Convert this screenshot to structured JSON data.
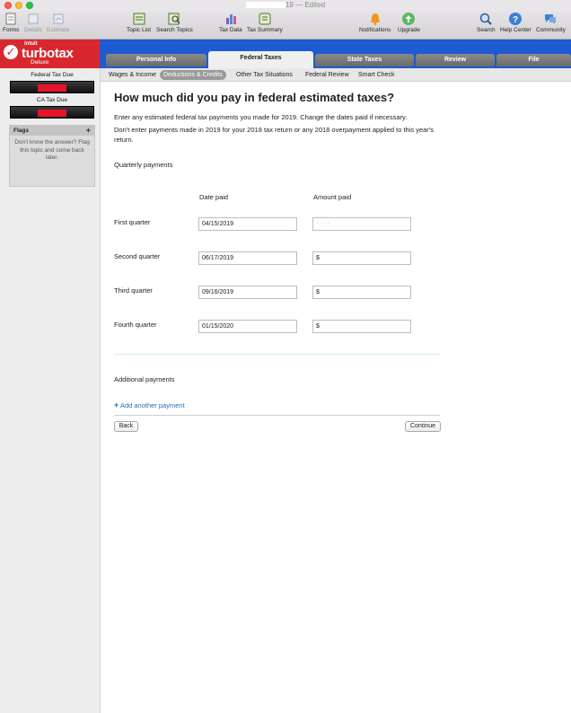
{
  "window": {
    "title": "19 — Edited"
  },
  "toolbar": {
    "left": [
      {
        "label": "Forms",
        "icon": "forms-icon"
      },
      {
        "label": "Details",
        "icon": "details-icon"
      },
      {
        "label": "Estimate",
        "icon": "estimate-icon"
      },
      {
        "label": "Topic List",
        "icon": "topic-list-icon"
      },
      {
        "label": "Search Topics",
        "icon": "search-topics-icon"
      },
      {
        "label": "Tax Data",
        "icon": "tax-data-icon"
      },
      {
        "label": "Tax Summary",
        "icon": "tax-summary-icon"
      }
    ],
    "right": [
      {
        "label": "Notifications",
        "icon": "bell-icon"
      },
      {
        "label": "Upgrade",
        "icon": "upgrade-icon"
      },
      {
        "label": "Search",
        "icon": "search-icon"
      },
      {
        "label": "Help Center",
        "icon": "help-icon"
      },
      {
        "label": "Community",
        "icon": "community-icon"
      }
    ]
  },
  "brand": {
    "intuit": "intuit",
    "name": "turbotax",
    "edition": "Deluxe"
  },
  "main_tabs": [
    {
      "label": "Personal Info"
    },
    {
      "label": "Federal Taxes"
    },
    {
      "label": "State Taxes"
    },
    {
      "label": "Review"
    },
    {
      "label": "File"
    }
  ],
  "sub_tabs": [
    {
      "label": "Wages & Income"
    },
    {
      "label": "Deductions & Credits"
    },
    {
      "label": "Other Tax Situations"
    },
    {
      "label": "Federal Review"
    },
    {
      "label": "Smart Check"
    }
  ],
  "sidebar": {
    "federal_label": "Federal Tax Due",
    "state_label": "CA Tax Due",
    "flags_title": "Flags",
    "flags_text": "Don't know the answer? Flag this topic and come back later."
  },
  "page": {
    "heading": "How much did you pay in federal estimated taxes?",
    "intro": "Enter any estimated federal tax payments you made for 2019. Change the dates paid if necessary.",
    "note": "Don't enter payments made in 2019 for your 2018 tax return or any 2018 overpayment applied to this year's return.",
    "quarterly_label": "Quarterly payments",
    "col_date": "Date paid",
    "col_amount": "Amount paid",
    "quarters": [
      {
        "label": "First quarter",
        "date": "04/15/2019",
        "amount": "- - - -"
      },
      {
        "label": "Second quarter",
        "date": "06/17/2019",
        "amount": "$"
      },
      {
        "label": "Third quarter",
        "date": "09/16/2019",
        "amount": "$"
      },
      {
        "label": "Fourth quarter",
        "date": "01/15/2020",
        "amount": "$"
      }
    ],
    "additional_label": "Additional payments",
    "add_link": "Add another payment",
    "back": "Back",
    "continue": "Continue"
  }
}
